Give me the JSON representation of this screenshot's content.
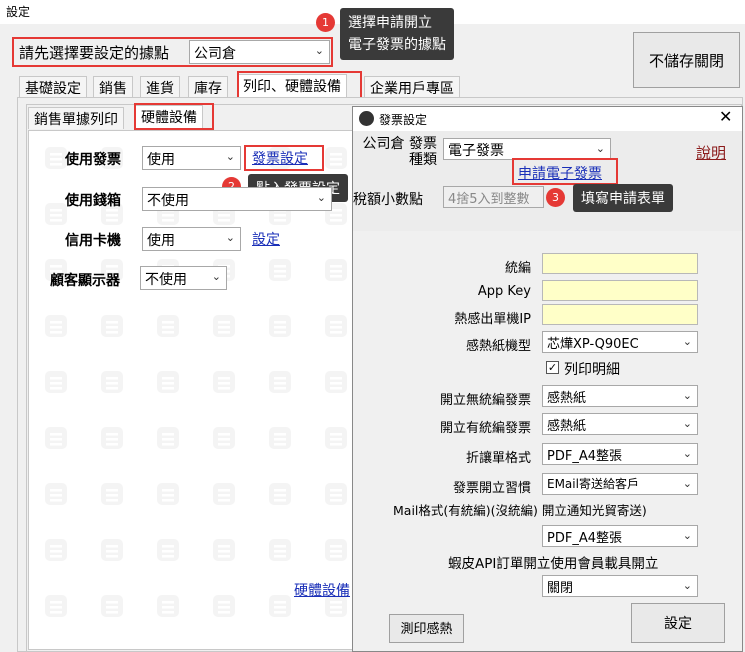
{
  "window": {
    "title": "設定"
  },
  "location": {
    "label": "請先選擇要設定的據點",
    "value": "公司倉"
  },
  "no_save_close": "不儲存關閉",
  "tabs": [
    "基礎設定",
    "銷售",
    "進貨",
    "庫存",
    "列印、硬體設備",
    "企業用戶專區"
  ],
  "subtabs": [
    "銷售單據列印",
    "硬體設備"
  ],
  "hardware": {
    "invoice_label": "使用發票",
    "invoice_value": "使用",
    "invoice_link": "發票設定",
    "drawer_label": "使用錢箱",
    "drawer_value": "不使用",
    "card_label": "信用卡機",
    "card_value": "使用",
    "card_link": "設定",
    "display_label": "顧客顯示器",
    "display_value": "不使用",
    "footer_link": "硬體設備"
  },
  "callouts": [
    {
      "num": "1",
      "text": "選擇申請開立\n電子發票的據點"
    },
    {
      "num": "2",
      "text": "點入發票設定"
    },
    {
      "num": "3",
      "text": "填寫申請表單"
    }
  ],
  "dialog": {
    "title": "發票設定",
    "type_label": "公司倉 發票種類",
    "type_value": "電子發票",
    "help": "說明",
    "apply_link": "申請電子發票",
    "tax_label": "稅額小數點",
    "tax_value": "4捨5入到整數",
    "fields": {
      "tax_id": "統編",
      "app_key": "App Key",
      "printer_ip": "熱感出單機IP",
      "paper_model_label": "感熱紙機型",
      "paper_model_value": "芯燁XP-Q90EC",
      "print_detail": "列印明細",
      "no_tax_label": "開立無統編發票",
      "no_tax_value": "感熱紙",
      "with_tax_label": "開立有統編發票",
      "with_tax_value": "感熱紙",
      "discount_label": "折讓單格式",
      "discount_value": "PDF_A4整張",
      "habit_label": "發票開立習慣",
      "habit_value": "EMail寄送給客戶",
      "mail_label": "Mail格式(有統編)(沒統編) 開立通知光貿寄送)",
      "mail_value": "PDF_A4整張",
      "shopee_label": "蝦皮API訂單開立使用會員載具開立",
      "shopee_value": "關閉"
    },
    "test_print": "測印感熱",
    "set": "設定"
  },
  "colors": {
    "red": "#e53935",
    "link": "#1a2fb8",
    "yellow": "#ffffc8"
  }
}
